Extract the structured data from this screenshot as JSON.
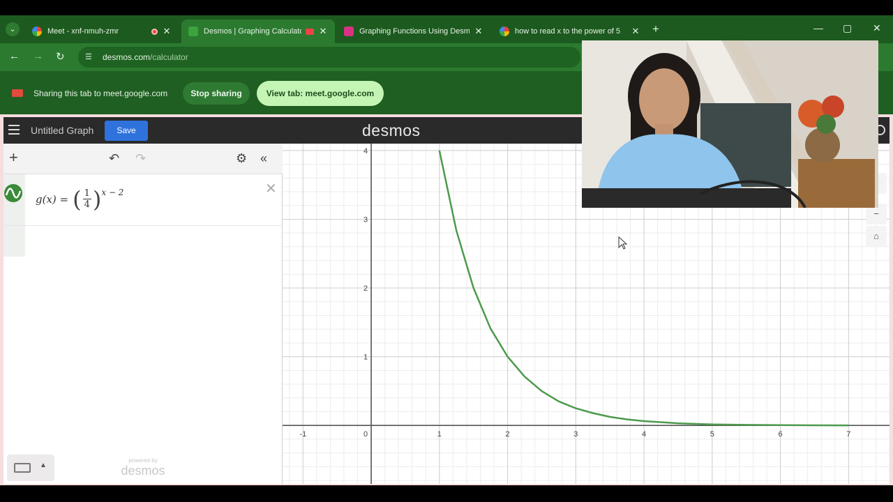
{
  "browser": {
    "tabs": [
      {
        "title": "Meet - xnf-nmuh-zmr",
        "active": false
      },
      {
        "title": "Desmos | Graphing Calculator",
        "active": true
      },
      {
        "title": "Graphing Functions Using Desmos",
        "active": false
      },
      {
        "title": "how to read x to the power of 5",
        "active": false
      }
    ],
    "url_domain": "desmos.com",
    "url_path": "/calculator"
  },
  "share_bar": {
    "message": "Sharing this tab to meet.google.com",
    "stop_label": "Stop sharing",
    "view_label": "View tab: meet.google.com"
  },
  "desmos": {
    "graph_title": "Untitled Graph",
    "save_label": "Save",
    "logo": "desmos",
    "expression": {
      "lhs": "g(x) =",
      "frac_num": "1",
      "frac_den": "4",
      "exponent": "x − 2",
      "color": "#4c9a4c"
    },
    "powered_by": "powered by",
    "powered_logo": "desmos"
  },
  "chart_data": {
    "type": "line",
    "x": [
      1,
      1.25,
      1.5,
      1.75,
      2,
      2.25,
      2.5,
      2.75,
      3,
      3.25,
      3.5,
      3.75,
      4,
      4.5,
      5,
      5.5,
      6,
      6.5,
      7
    ],
    "series": [
      {
        "values": [
          4,
          2.83,
          2,
          1.41,
          1,
          0.71,
          0.5,
          0.35,
          0.25,
          0.18,
          0.125,
          0.088,
          0.0625,
          0.031,
          0.0156,
          0.0078,
          0.0039,
          0.002,
          0.001
        ]
      }
    ],
    "x_ticks": [
      "-1",
      "0",
      "1",
      "2",
      "3",
      "4",
      "5",
      "6",
      "7"
    ],
    "y_ticks": [
      "1",
      "2",
      "3",
      "4"
    ],
    "xlim": [
      -1.3,
      7.6
    ],
    "ylim": [
      -0.85,
      4.1
    ],
    "grid": true,
    "line_color": "#4c9a4c"
  }
}
